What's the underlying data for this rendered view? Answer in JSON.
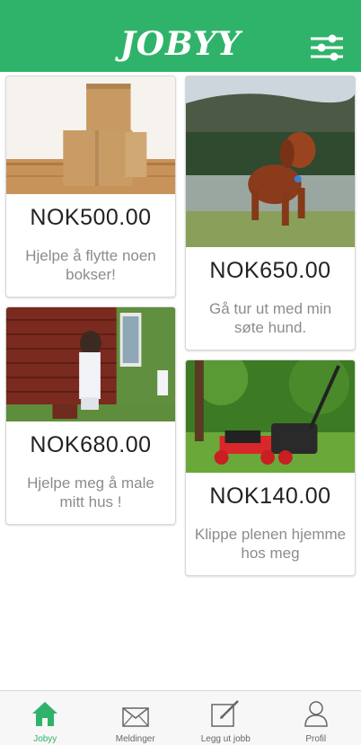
{
  "header": {
    "title": "JOBYY"
  },
  "jobs": [
    {
      "price": "NOK500.00",
      "description": "Hjelpe å flytte noen bokser!"
    },
    {
      "price": "NOK650.00",
      "description": "Gå tur ut med min søte hund."
    },
    {
      "price": "NOK680.00",
      "description": "Hjelpe meg å male mitt hus !"
    },
    {
      "price": "NOK140.00",
      "description": "Klippe plenen hjemme hos meg"
    }
  ],
  "nav": {
    "items": [
      {
        "label": "Jobyy",
        "icon": "home-icon"
      },
      {
        "label": "Meldinger",
        "icon": "envelope-icon"
      },
      {
        "label": "Legg ut jobb",
        "icon": "edit-icon"
      },
      {
        "label": "Profil",
        "icon": "user-icon"
      }
    ]
  },
  "colors": {
    "accent": "#2fb36b",
    "price_text": "#222222",
    "desc_text": "#8c8c8c"
  }
}
